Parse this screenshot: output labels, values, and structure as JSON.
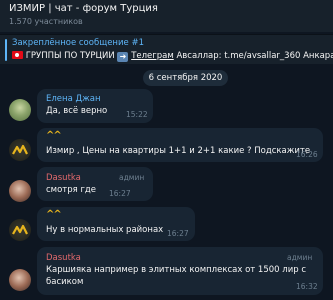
{
  "header": {
    "title": "ИЗМИР | чат - форум Турция",
    "subtitle": "1.570 участников"
  },
  "pinned": {
    "title": "Закреплённое сообщение #1",
    "text_before": "ГРУППЫ ПО ТУРЦИИ",
    "link": "Телеграм",
    "text_after": "Авсаллар: t.me/avsallar_360 Анкара"
  },
  "date_separator": "6 сентября 2020",
  "messages": [
    {
      "author": "Елена Джан",
      "author_color": "#5eb5f7",
      "text": "Да, всё верно",
      "time": "15:22"
    },
    {
      "author": "^^",
      "text": "Измир , Цены на квартиры 1+1 и 2+1 какие ? Подскажите",
      "time": "16:26"
    },
    {
      "author": "Dasutka",
      "author_color": "#e2696c",
      "role": "админ",
      "text": "смотря где",
      "time": "16:27"
    },
    {
      "author": "^^",
      "text": "Ну в нормальных районах",
      "time": "16:27"
    },
    {
      "author": "Dasutka",
      "author_color": "#e2696c",
      "role": "админ",
      "text_line1": "Каршияка например в элитных комплексах от 1500 лир с",
      "text_line2": "басиком",
      "time": "16:32"
    }
  ],
  "colors": {
    "background": "#0e1621",
    "bubble": "#182533",
    "accent": "#5eb5f7",
    "admin_name": "#e2696c",
    "logo": "#e8b51d"
  },
  "icons": {
    "flag": "turkey-flag-icon",
    "arrow": "right-arrow-icon"
  }
}
